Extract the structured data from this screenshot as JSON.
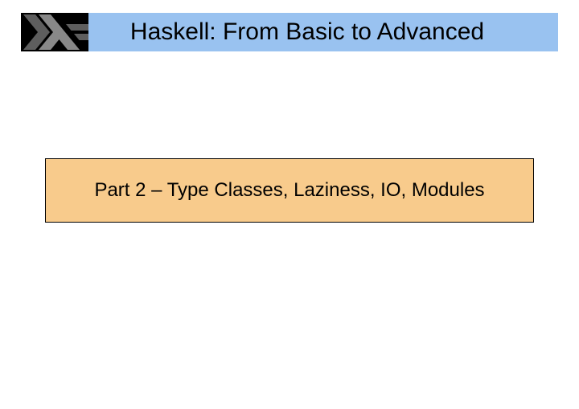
{
  "slide": {
    "title": "Haskell: From Basic to Advanced",
    "subtitle": "Part 2 – Type Classes, Laziness, IO, Modules"
  }
}
